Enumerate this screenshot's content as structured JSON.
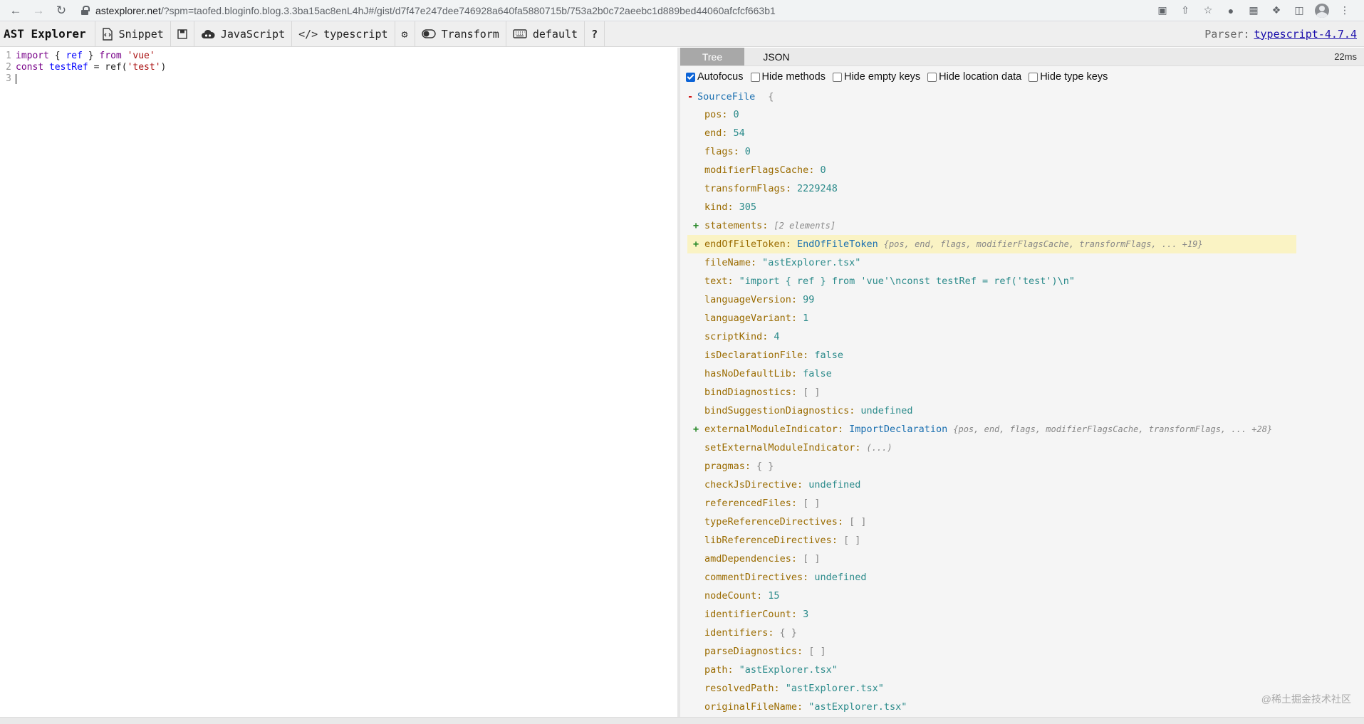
{
  "browser": {
    "url_host": "astexplorer.net",
    "url_rest": "/?spm=taofed.bloginfo.blog.3.3ba15ac8enL4hJ#/gist/d7f47e247dee746928a640fa5880715b/753a2b0c72aeebc1d889bed44060afcfcf663b1"
  },
  "toolbar": {
    "brand": "AST Explorer",
    "snippet": "Snippet",
    "language": "JavaScript",
    "parser_short": "typescript",
    "transform": "Transform",
    "keymap": "default",
    "help": "?",
    "parser_label": "Parser:",
    "parser_link": "typescript-4.7.4"
  },
  "editor": {
    "lines": [
      {
        "num": "1"
      },
      {
        "num": "2"
      },
      {
        "num": "3"
      }
    ],
    "tokens": {
      "import": "import",
      "open": " { ",
      "ref": "ref",
      "close": " } ",
      "from": "from",
      "sp": " ",
      "vue": "'vue'",
      "const": "const",
      "testRef": "testRef",
      "eq_ref": " = ref(",
      "test": "'test'",
      "rparen": ")"
    }
  },
  "output": {
    "tab_tree": "Tree",
    "tab_json": "JSON",
    "time": "22ms",
    "options": {
      "autofocus": "Autofocus",
      "hide_methods": "Hide methods",
      "hide_empty": "Hide empty keys",
      "hide_location": "Hide location data",
      "hide_type": "Hide type keys"
    },
    "root": {
      "toggle": "-",
      "name": "SourceFile",
      "brace": "{"
    },
    "rows": [
      {
        "key": "pos",
        "val": "0",
        "kind": "num"
      },
      {
        "key": "end",
        "val": "54",
        "kind": "num"
      },
      {
        "key": "flags",
        "val": "0",
        "kind": "num"
      },
      {
        "key": "modifierFlagsCache",
        "val": "0",
        "kind": "num"
      },
      {
        "key": "transformFlags",
        "val": "2229248",
        "kind": "num"
      },
      {
        "key": "kind",
        "val": "305",
        "kind": "num"
      },
      {
        "key": "statements",
        "val": "[2 elements]",
        "kind": "ital",
        "toggle": "+"
      },
      {
        "key": "endOfFileToken",
        "val": "EndOfFileToken",
        "extra": "{pos, end, flags, modifierFlagsCache, transformFlags, ... +19}",
        "kind": "type",
        "toggle": "+",
        "highlight": true
      },
      {
        "key": "fileName",
        "val": "\"astExplorer.tsx\"",
        "kind": "str"
      },
      {
        "key": "text",
        "val": "\"import { ref } from 'vue'\\nconst testRef = ref('test')\\n\"",
        "kind": "str"
      },
      {
        "key": "languageVersion",
        "val": "99",
        "kind": "num"
      },
      {
        "key": "languageVariant",
        "val": "1",
        "kind": "num"
      },
      {
        "key": "scriptKind",
        "val": "4",
        "kind": "num"
      },
      {
        "key": "isDeclarationFile",
        "val": "false",
        "kind": "bool"
      },
      {
        "key": "hasNoDefaultLib",
        "val": "false",
        "kind": "bool"
      },
      {
        "key": "bindDiagnostics",
        "val": "[ ]",
        "kind": "muted"
      },
      {
        "key": "bindSuggestionDiagnostics",
        "val": "undefined",
        "kind": "bool"
      },
      {
        "key": "externalModuleIndicator",
        "val": "ImportDeclaration",
        "extra": "{pos, end, flags, modifierFlagsCache, transformFlags, ... +28}",
        "kind": "type",
        "toggle": "+"
      },
      {
        "key": "setExternalModuleIndicator",
        "val": "(...)",
        "kind": "ital"
      },
      {
        "key": "pragmas",
        "val": "{ }",
        "kind": "muted"
      },
      {
        "key": "checkJsDirective",
        "val": "undefined",
        "kind": "bool"
      },
      {
        "key": "referencedFiles",
        "val": "[ ]",
        "kind": "muted"
      },
      {
        "key": "typeReferenceDirectives",
        "val": "[ ]",
        "kind": "muted"
      },
      {
        "key": "libReferenceDirectives",
        "val": "[ ]",
        "kind": "muted"
      },
      {
        "key": "amdDependencies",
        "val": "[ ]",
        "kind": "muted"
      },
      {
        "key": "commentDirectives",
        "val": "undefined",
        "kind": "bool"
      },
      {
        "key": "nodeCount",
        "val": "15",
        "kind": "num"
      },
      {
        "key": "identifierCount",
        "val": "3",
        "kind": "num"
      },
      {
        "key": "identifiers",
        "val": "{ }",
        "kind": "muted"
      },
      {
        "key": "parseDiagnostics",
        "val": "[ ]",
        "kind": "muted"
      },
      {
        "key": "path",
        "val": "\"astExplorer.tsx\"",
        "kind": "str"
      },
      {
        "key": "resolvedPath",
        "val": "\"astExplorer.tsx\"",
        "kind": "str"
      },
      {
        "key": "originalFileName",
        "val": "\"astExplorer.tsx\"",
        "kind": "str"
      }
    ]
  },
  "watermark": "@稀土掘金技术社区"
}
